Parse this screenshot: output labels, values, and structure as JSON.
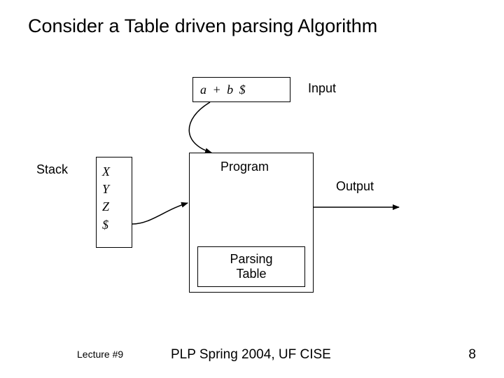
{
  "title": "Consider a Table driven parsing Algorithm",
  "input": {
    "tape": "a + b $",
    "label": "Input"
  },
  "stack": {
    "label": "Stack",
    "items": [
      "X",
      "Y",
      "Z",
      "$"
    ]
  },
  "program": {
    "label": "Program"
  },
  "output": {
    "label": "Output"
  },
  "parsing_table": {
    "line1": "Parsing",
    "line2": "Table"
  },
  "footer": {
    "left": "Lecture #9",
    "center": "PLP Spring 2004, UF CISE",
    "right": "8"
  }
}
